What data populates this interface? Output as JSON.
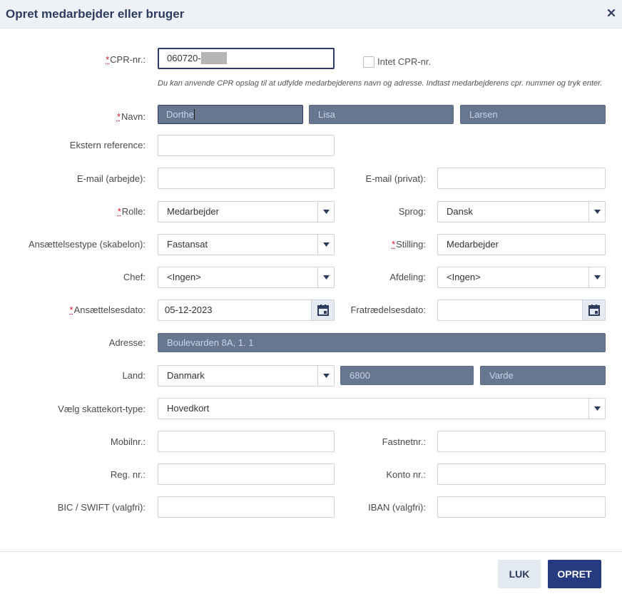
{
  "dialog": {
    "title": "Opret medarbejder eller bruger",
    "close_icon": "close-icon"
  },
  "required_marker": "*",
  "form": {
    "cpr": {
      "label": "CPR-nr.:",
      "value": "060720-",
      "required": true
    },
    "no_cpr": {
      "label": "Intet CPR-nr.",
      "checked": false
    },
    "hint": "Du kan anvende CPR opslag til at udfylde medarbejderens navn og adresse. Indtast medarbejderens cpr. nummer og tryk enter.",
    "name": {
      "label": "Navn:",
      "required": true,
      "first": "Dorthe",
      "middle": "Lisa",
      "last": "Larsen"
    },
    "external_ref": {
      "label": "Ekstern reference:",
      "value": ""
    },
    "email_work": {
      "label": "E-mail (arbejde):",
      "value": ""
    },
    "email_private": {
      "label": "E-mail (privat):",
      "value": ""
    },
    "role": {
      "label": "Rolle:",
      "value": "Medarbejder",
      "required": true
    },
    "language": {
      "label": "Sprog:",
      "value": "Dansk"
    },
    "employment_type": {
      "label": "Ansættelsestype (skabelon):",
      "value": "Fastansat"
    },
    "position": {
      "label": "Stilling:",
      "value": "Medarbejder",
      "required": true
    },
    "manager": {
      "label": "Chef:",
      "value": "<Ingen>"
    },
    "department": {
      "label": "Afdeling:",
      "value": "<Ingen>"
    },
    "start_date": {
      "label": "Ansættelsesdato:",
      "value": "05-12-2023",
      "required": true
    },
    "end_date": {
      "label": "Fratrædelsesdato:",
      "value": ""
    },
    "address": {
      "label": "Adresse:",
      "value": "Boulevarden 8A, 1. 1"
    },
    "country": {
      "label": "Land:",
      "value": "Danmark",
      "zip": "6800",
      "city": "Varde"
    },
    "tax_card": {
      "label": "Vælg skattekort-type:",
      "value": "Hovedkort"
    },
    "mobile": {
      "label": "Mobilnr.:",
      "value": ""
    },
    "landline": {
      "label": "Fastnetnr.:",
      "value": ""
    },
    "reg_no": {
      "label": "Reg. nr.:",
      "value": ""
    },
    "account_no": {
      "label": "Konto nr.:",
      "value": ""
    },
    "bic": {
      "label": "BIC / SWIFT (valgfri):",
      "value": ""
    },
    "iban": {
      "label": "IBAN (valgfri):",
      "value": ""
    }
  },
  "footer": {
    "close_label": "LUK",
    "create_label": "OPRET"
  },
  "colors": {
    "primary": "#263a80",
    "title": "#2d3b5e",
    "prefilled_bg": "#67778f",
    "required": "#d0142c"
  }
}
